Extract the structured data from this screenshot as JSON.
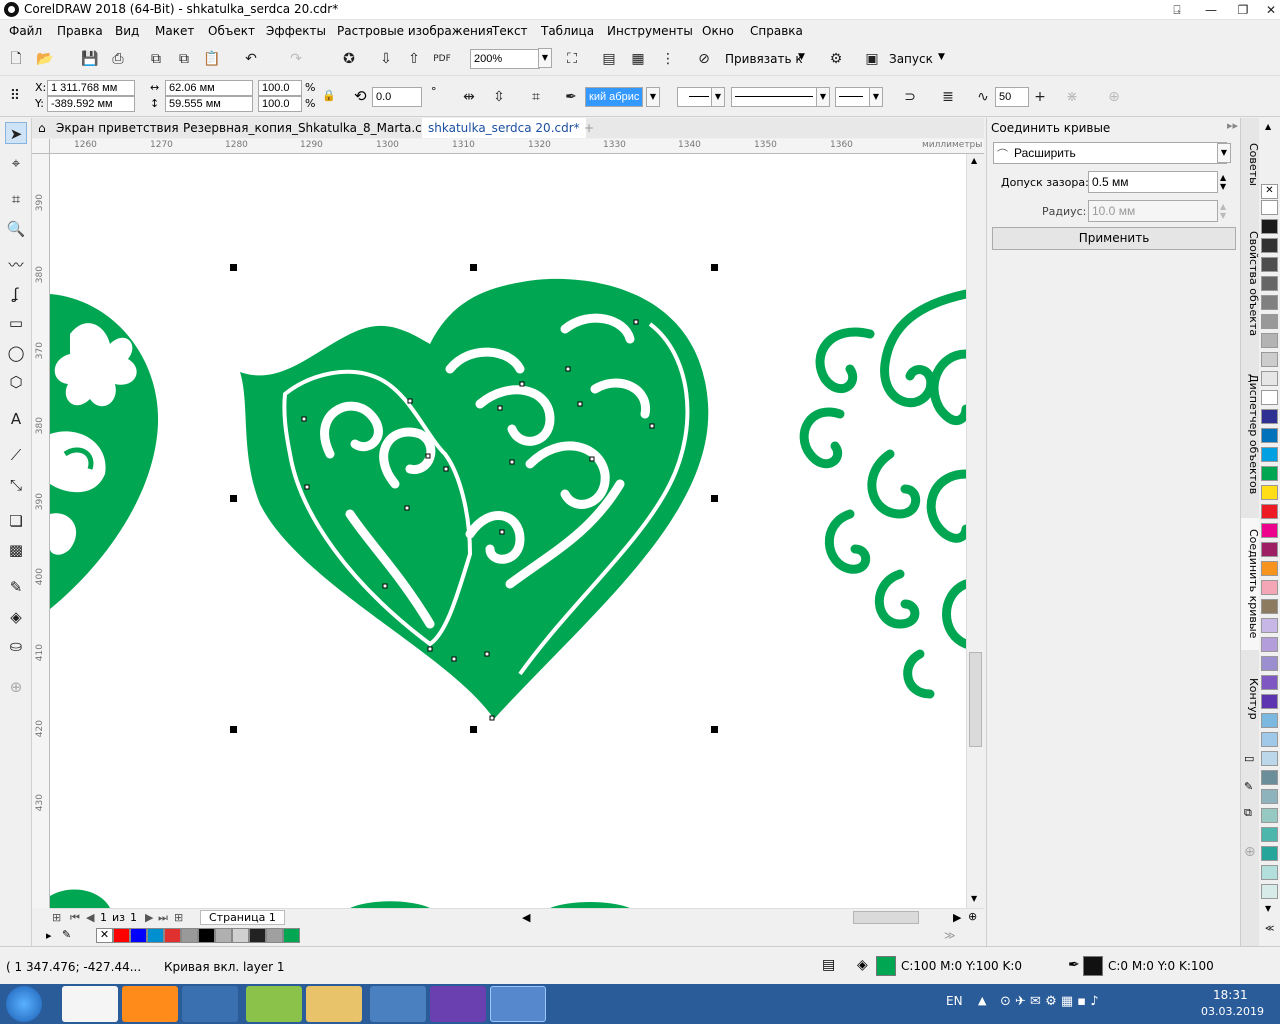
{
  "window": {
    "title": "CorelDRAW 2018 (64-Bit) - shkatulka_serdca 20.cdr*"
  },
  "menu": [
    "Файл",
    "Правка",
    "Вид",
    "Макет",
    "Объект",
    "Эффекты",
    "Растровые изображения",
    "Текст",
    "Таблица",
    "Инструменты",
    "Окно",
    "Справка"
  ],
  "toolbar": {
    "zoom": "200%",
    "snap_label": "Привязать к",
    "launch_label": "Запуск"
  },
  "propbar": {
    "x_label": "X:",
    "x": "1 311.768 мм",
    "y_label": "Y:",
    "y": "-389.592 мм",
    "w": "62.06 мм",
    "h": "59.555 мм",
    "sx": "100.0",
    "sy": "100.0",
    "pct": "%",
    "rotation": "0.0",
    "outline": "кий абрис",
    "smooth": "50"
  },
  "tabs": [
    "Экран приветствия",
    "Резервная_копия_Shkatulka_8_Marta.cdr*",
    "shkatulka_serdca 20.cdr*"
  ],
  "ruler": {
    "h_labels": [
      "1260",
      "1270",
      "1280",
      "1290",
      "1300",
      "1310",
      "1320",
      "1330",
      "1340",
      "1350",
      "1360"
    ],
    "unit": "миллиметры",
    "v_labels": [
      "390",
      "380",
      "370",
      "380",
      "390",
      "400",
      "410",
      "420",
      "430"
    ]
  },
  "page_nav": {
    "current": "1",
    "of_label": "из",
    "total": "1",
    "page_tab": "Страница 1"
  },
  "docker": {
    "title": "Соединить кривые",
    "mode": "Расширить",
    "gap_label": "Допуск зазора:",
    "gap_value": "0.5 мм",
    "radius_label": "Радиус:",
    "radius_value": "10.0 мм",
    "apply": "Применить"
  },
  "docker_tabs": [
    "Советы",
    "Свойства объекта",
    "Диспетчер объектов",
    "Соединить кривые",
    "Контур"
  ],
  "palette_colors": [
    "#ffffff",
    "#1a1a1a",
    "#333333",
    "#4d4d4d",
    "#666666",
    "#808080",
    "#999999",
    "#b3b3b3",
    "#cccccc",
    "#e6e6e6",
    "#ffffff",
    "#2e3192",
    "#0072bc",
    "#00a0e3",
    "#00a651",
    "#ffde17",
    "#ed1c24",
    "#ec008c",
    "#9e1f63",
    "#f7941d",
    "#f4a6b7",
    "#8d7b5f",
    "#c7b7e6",
    "#b39ddb",
    "#9b8fd0",
    "#7e57c2",
    "#5e35b1",
    "#7ab8e0",
    "#a0c8e8",
    "#bcd6ea",
    "#6b8e9a",
    "#8fb3bd",
    "#96c9c2",
    "#4db6ac",
    "#26a69a",
    "#b2dfdb",
    "#d7ebe8"
  ],
  "doc_palette": [
    "#ff0000",
    "#0000ff",
    "#0090d0",
    "#e03030",
    "#999999",
    "#000000",
    "#b0b0b0",
    "#d0d0d0",
    "#222222",
    "#a0a0a0",
    "#00a651"
  ],
  "status": {
    "coords": "( 1 347.476; -427.44...",
    "object": "Кривая вкл. layer 1",
    "fill": "C:100 M:0 Y:100 K:0",
    "outline": "C:0 M:0 Y:0 K:100"
  },
  "colors": {
    "art_green": "#00a651"
  },
  "taskbar": {
    "lang": "EN",
    "time": "18:31",
    "date": "03.03.2019"
  }
}
